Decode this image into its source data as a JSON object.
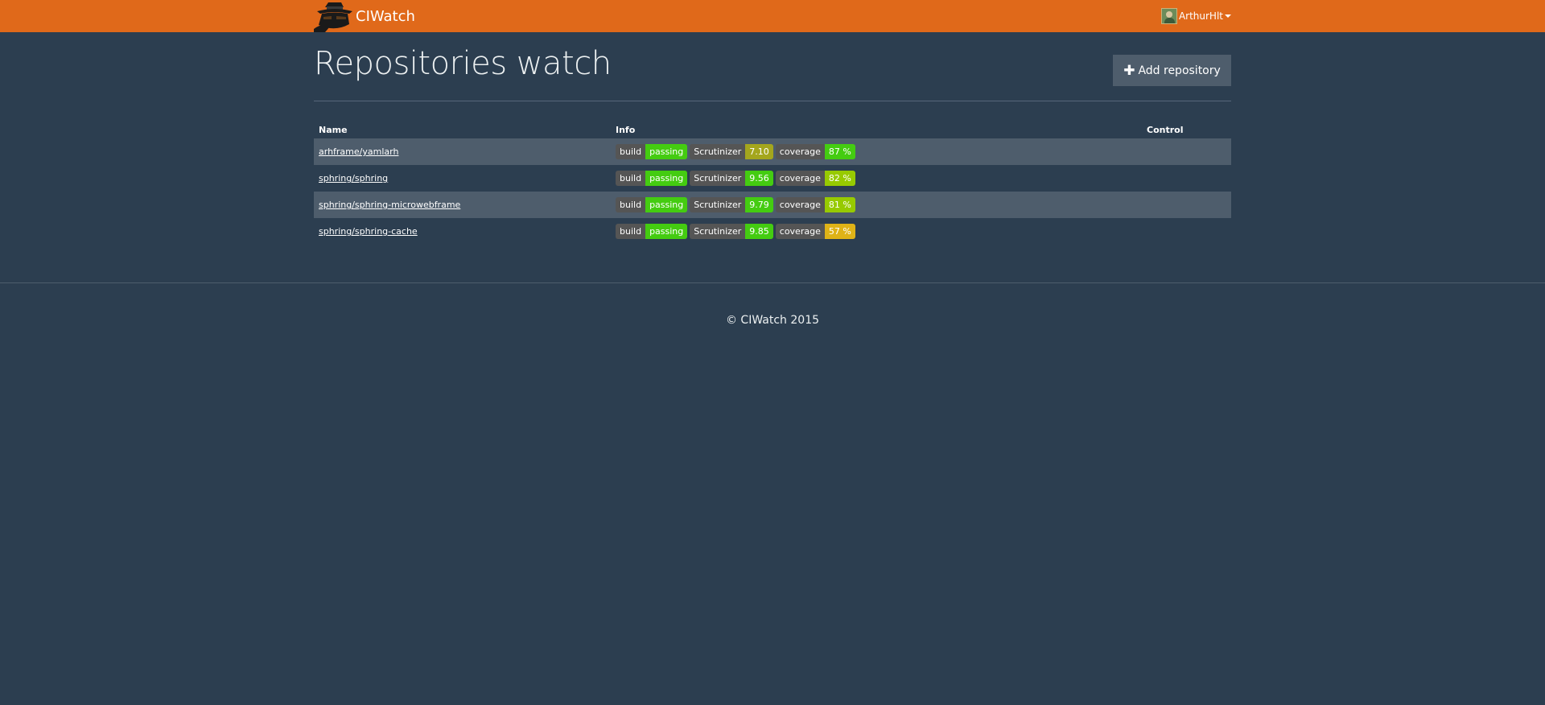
{
  "navbar": {
    "brand": "CIWatch",
    "user": "ArthurHlt"
  },
  "header": {
    "title": "Repositories watch",
    "add_button": "Add repository"
  },
  "table": {
    "columns": {
      "name": "Name",
      "info": "Info",
      "control": "Control"
    },
    "rows": [
      {
        "name": "arhframe/yamlarh",
        "build_label": "build",
        "build_value": "passing",
        "build_color": "#4c1",
        "scrutinizer_label": "Scrutinizer",
        "scrutinizer_value": "7.10",
        "scrutinizer_color": "#a4a61d",
        "coverage_label": "coverage",
        "coverage_value": "87 %",
        "coverage_color": "#4c1"
      },
      {
        "name": "sphring/sphring",
        "build_label": "build",
        "build_value": "passing",
        "build_color": "#4c1",
        "scrutinizer_label": "Scrutinizer",
        "scrutinizer_value": "9.56",
        "scrutinizer_color": "#4c1",
        "coverage_label": "coverage",
        "coverage_value": "82 %",
        "coverage_color": "#97ca00"
      },
      {
        "name": "sphring/sphring-microwebframe",
        "build_label": "build",
        "build_value": "passing",
        "build_color": "#4c1",
        "scrutinizer_label": "Scrutinizer",
        "scrutinizer_value": "9.79",
        "scrutinizer_color": "#4c1",
        "coverage_label": "coverage",
        "coverage_value": "81 %",
        "coverage_color": "#97ca00"
      },
      {
        "name": "sphring/sphring-cache",
        "build_label": "build",
        "build_value": "passing",
        "build_color": "#4c1",
        "scrutinizer_label": "Scrutinizer",
        "scrutinizer_value": "9.85",
        "scrutinizer_color": "#4c1",
        "coverage_label": "coverage",
        "coverage_value": "57 %",
        "coverage_color": "#dfb317"
      }
    ]
  },
  "footer": {
    "text": "© CIWatch 2015"
  },
  "colors": {
    "navbar": "#e0691a",
    "background": "#2c3e50",
    "row_stripe": "#4e5d6c",
    "badge_label": "#555555"
  }
}
